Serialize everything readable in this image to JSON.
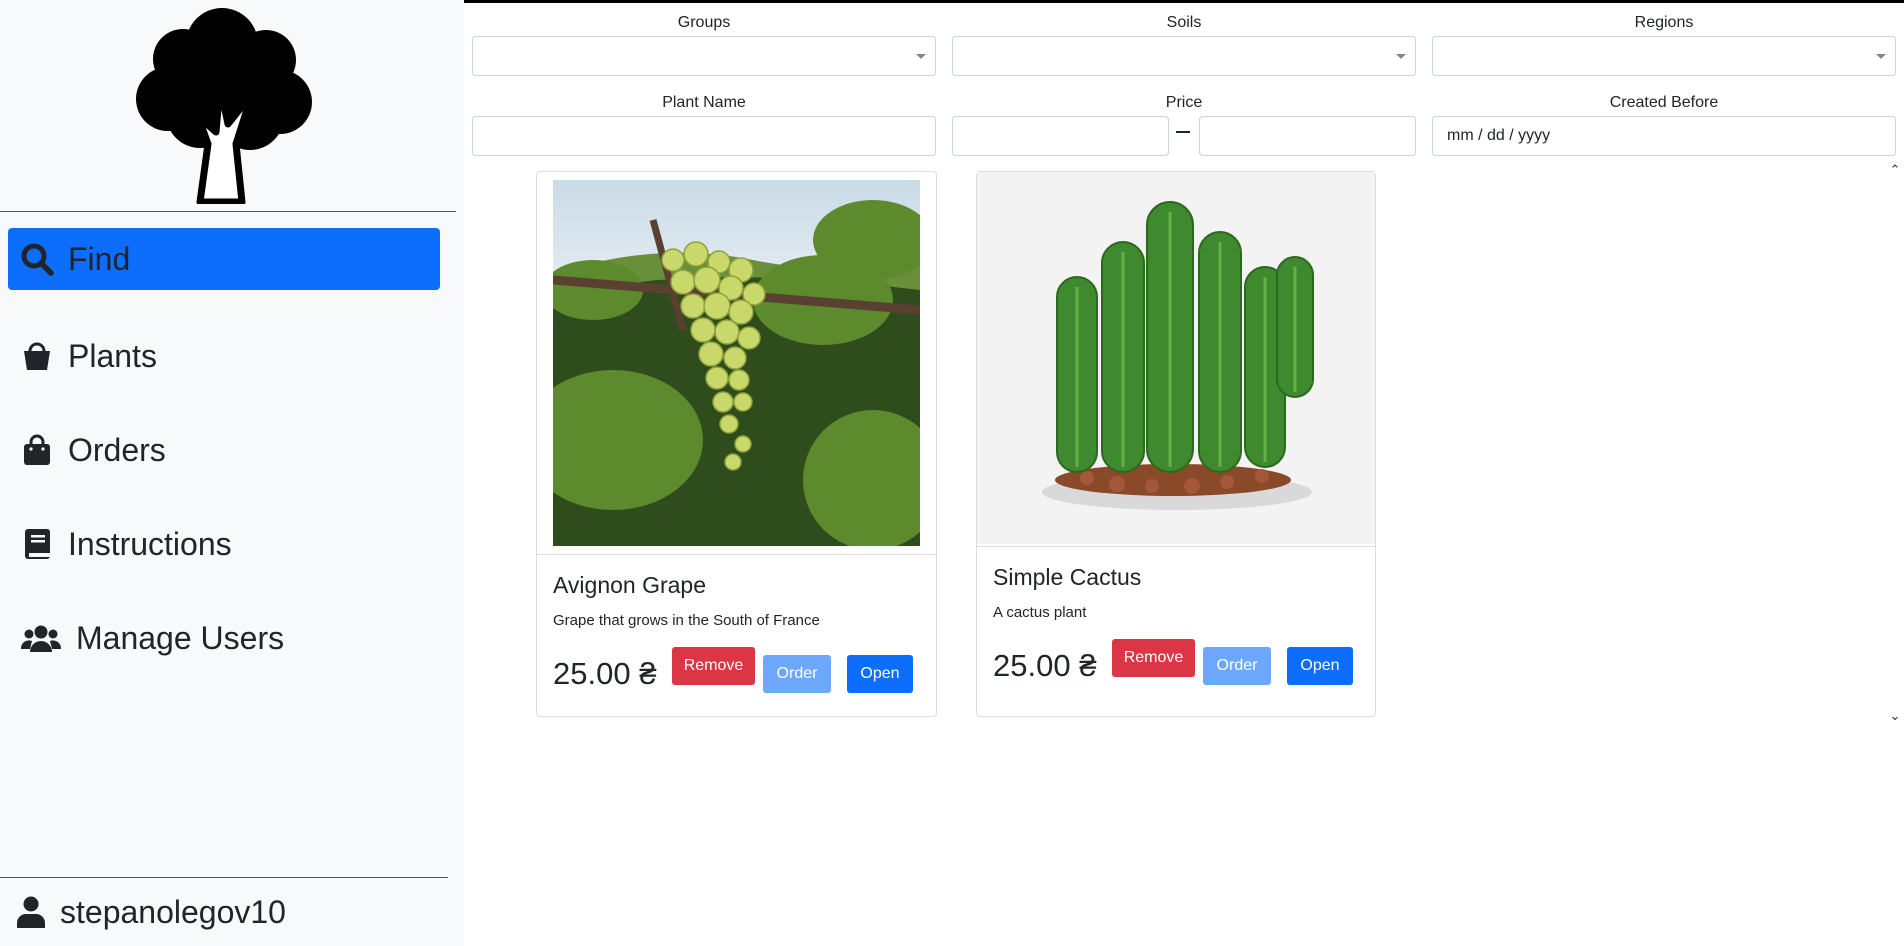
{
  "sidebar": {
    "logo": "tree-icon",
    "nav": [
      {
        "label": "Find",
        "icon": "search-icon",
        "active": true
      },
      {
        "label": "Plants",
        "icon": "basket-icon",
        "active": false
      },
      {
        "label": "Orders",
        "icon": "shopping-bag-icon",
        "active": false
      },
      {
        "label": "Instructions",
        "icon": "book-icon",
        "active": false
      },
      {
        "label": "Manage Users",
        "icon": "users-icon",
        "active": false
      }
    ],
    "user": {
      "name": "stepanolegov10",
      "icon": "user-icon"
    }
  },
  "filters": {
    "groups": {
      "label": "Groups",
      "value": ""
    },
    "soils": {
      "label": "Soils",
      "value": ""
    },
    "regions": {
      "label": "Regions",
      "value": ""
    },
    "plant_name": {
      "label": "Plant Name",
      "value": ""
    },
    "price": {
      "label": "Price",
      "min": "",
      "max": ""
    },
    "created_before": {
      "label": "Created Before",
      "placeholder": "mm / dd / yyyy"
    }
  },
  "plants": [
    {
      "name": "Avignon Grape",
      "description": "Grape that grows in the South of France",
      "price": "25.00 ₴",
      "remove_label": "Remove",
      "order_label": "Order",
      "open_label": "Open"
    },
    {
      "name": "Simple Cactus",
      "description": "A cactus plant",
      "price": "25.00 ₴",
      "remove_label": "Remove",
      "order_label": "Order",
      "open_label": "Open"
    }
  ],
  "colors": {
    "accent": "#0d6efd",
    "danger": "#dc3545",
    "order_disabled": "#6ea8fe",
    "sidebar_bg": "#f8f9fa"
  }
}
